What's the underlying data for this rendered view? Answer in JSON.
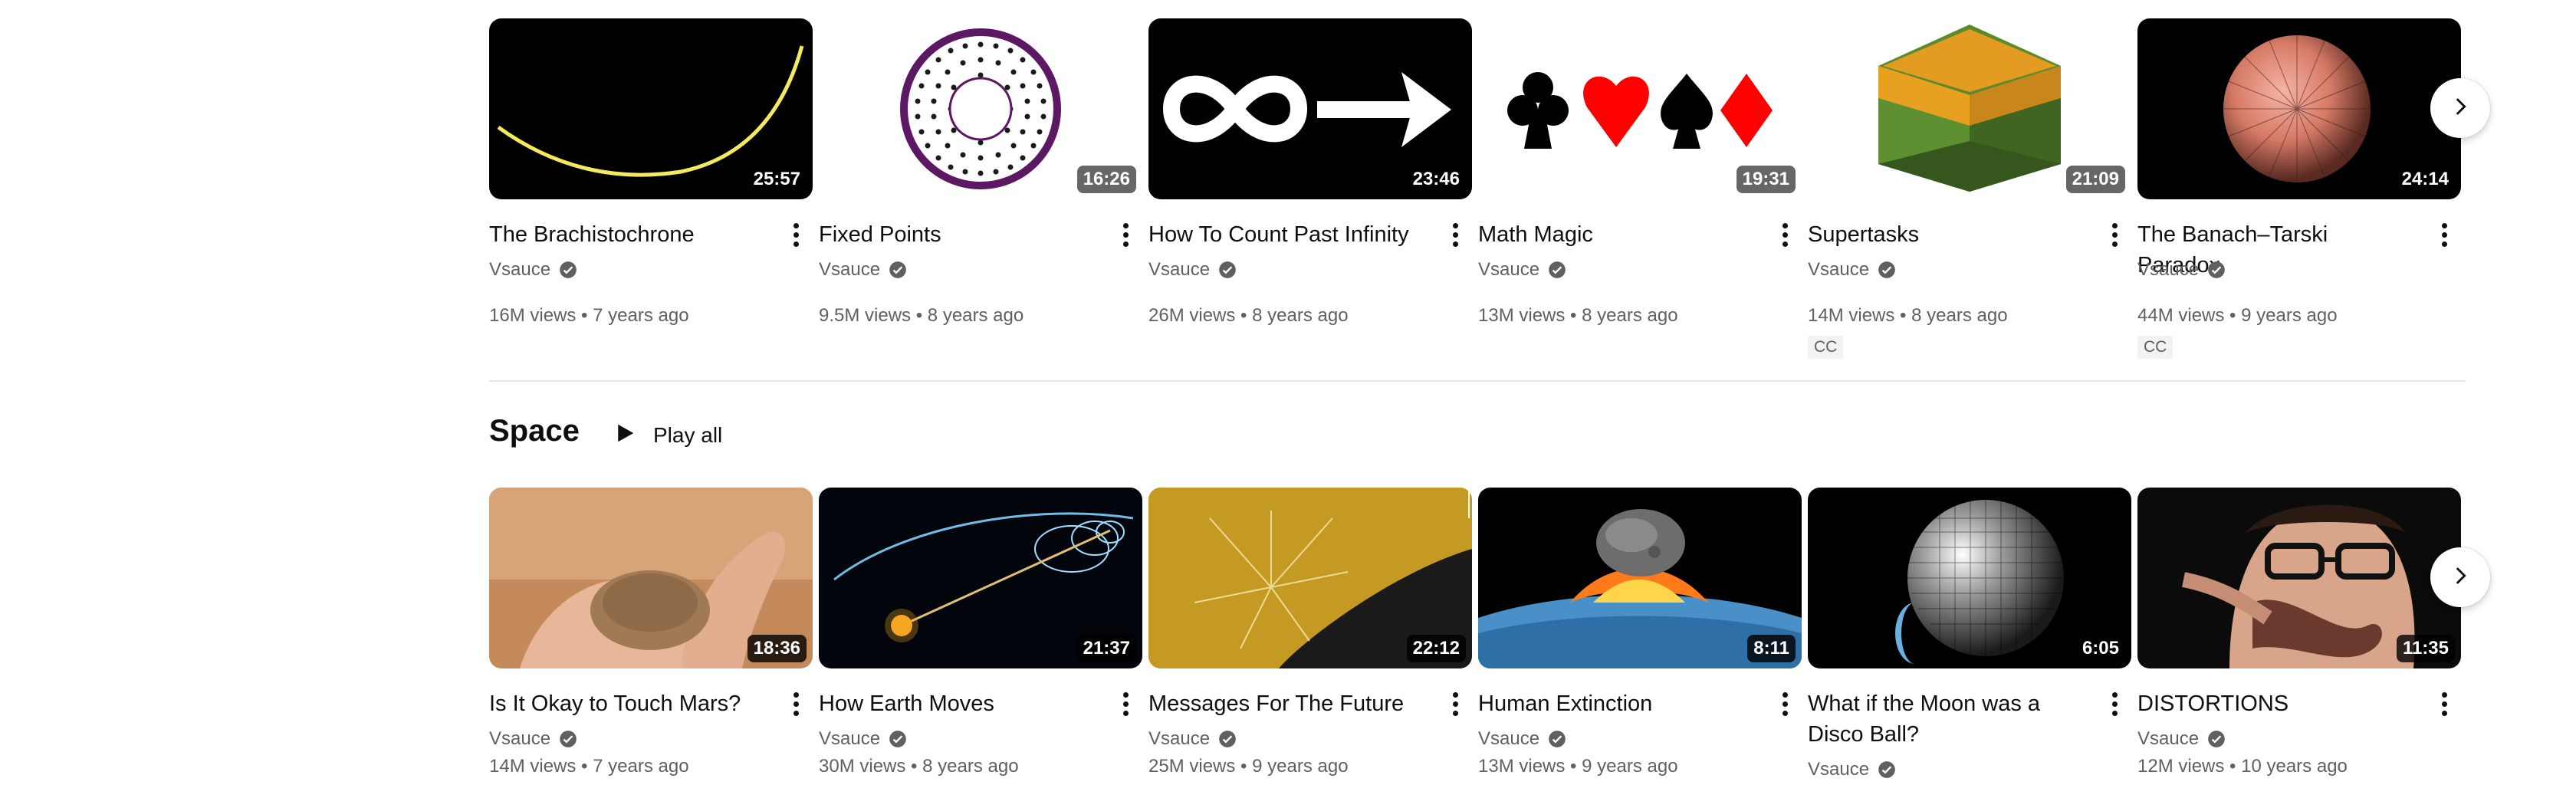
{
  "shelf1": {
    "videos": [
      {
        "title": "The Brachistochrone",
        "channel": "Vsauce",
        "views": "16M views",
        "age": "7 years ago",
        "duration": "25:57",
        "cc": ""
      },
      {
        "title": "Fixed Points",
        "channel": "Vsauce",
        "views": "9.5M views",
        "age": "8 years ago",
        "duration": "16:26",
        "cc": ""
      },
      {
        "title": "How To Count Past Infinity",
        "channel": "Vsauce",
        "views": "26M views",
        "age": "8 years ago",
        "duration": "23:46",
        "cc": ""
      },
      {
        "title": "Math Magic",
        "channel": "Vsauce",
        "views": "13M views",
        "age": "8 years ago",
        "duration": "19:31",
        "cc": ""
      },
      {
        "title": "Supertasks",
        "channel": "Vsauce",
        "views": "14M views",
        "age": "8 years ago",
        "duration": "21:09",
        "cc": "CC"
      },
      {
        "title": "The Banach–Tarski Paradox",
        "channel": "Vsauce",
        "views": "44M views",
        "age": "9 years ago",
        "duration": "24:14",
        "cc": "CC"
      }
    ]
  },
  "shelf2": {
    "title": "Space",
    "play_all": "Play all",
    "videos": [
      {
        "title": "Is It Okay to Touch Mars?",
        "channel": "Vsauce",
        "views": "14M views",
        "age": "7 years ago",
        "duration": "18:36"
      },
      {
        "title": "How Earth Moves",
        "channel": "Vsauce",
        "views": "30M views",
        "age": "8 years ago",
        "duration": "21:37"
      },
      {
        "title": "Messages For The Future",
        "channel": "Vsauce",
        "views": "25M views",
        "age": "9 years ago",
        "duration": "22:12"
      },
      {
        "title": "Human Extinction",
        "channel": "Vsauce",
        "views": "13M views",
        "age": "9 years ago",
        "duration": "8:11"
      },
      {
        "title": "What if the Moon was a Disco Ball?",
        "channel": "Vsauce",
        "views": "",
        "age": "",
        "duration": "6:05"
      },
      {
        "title": "DISTORTIONS",
        "channel": "Vsauce",
        "views": "12M views",
        "age": "10 years ago",
        "duration": "11:35"
      }
    ]
  },
  "icons": {
    "verified": "check-circle-icon",
    "more": "three-dots-vertical-icon",
    "next": "chevron-right-icon",
    "play": "play-triangle-icon"
  },
  "colors": {
    "text_primary": "#0f0f0f",
    "text_secondary": "#606060",
    "divider": "#e5e5e5"
  }
}
